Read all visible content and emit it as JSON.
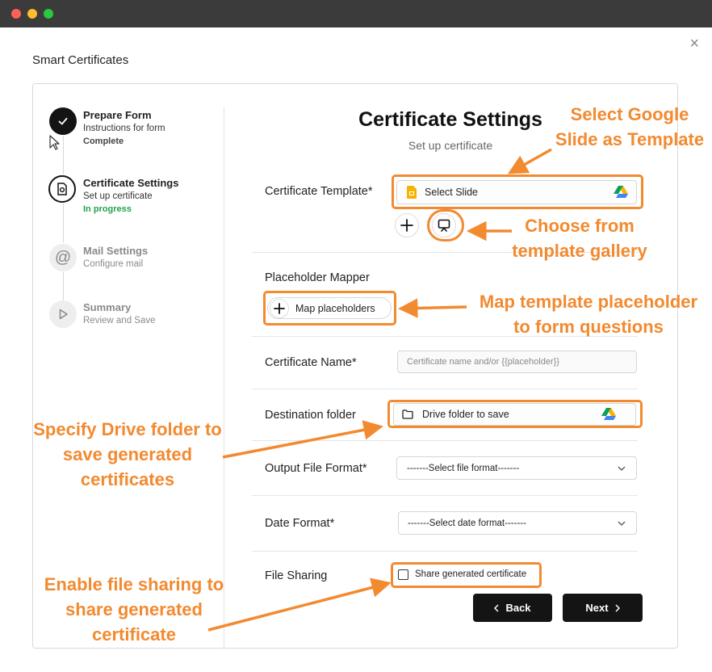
{
  "app": {
    "title": "Smart Certificates",
    "close_label": "×"
  },
  "steps": [
    {
      "title": "Prepare Form",
      "subtitle": "Instructions for form",
      "status": "Complete"
    },
    {
      "title": "Certificate Settings",
      "subtitle": "Set up certificate",
      "status": "In progress"
    },
    {
      "title": "Mail Settings",
      "subtitle": "Configure mail"
    },
    {
      "title": "Summary",
      "subtitle": "Review and Save"
    }
  ],
  "main": {
    "title": "Certificate Settings",
    "subtitle": "Set up certificate",
    "certificate_template": {
      "label": "Certificate Template*",
      "value": "Select Slide"
    },
    "placeholder_mapper": {
      "label": "Placeholder Mapper",
      "button": "Map placeholders"
    },
    "certificate_name": {
      "label": "Certificate Name*",
      "placeholder": "Certificate name and/or {{placeholder}}"
    },
    "destination_folder": {
      "label": "Destination folder",
      "value": "Drive folder to save"
    },
    "output_format": {
      "label": "Output File Format*",
      "value": "-------Select file format-------"
    },
    "date_format": {
      "label": "Date Format*",
      "value": "-------Select date format-------"
    },
    "file_sharing": {
      "label": "File Sharing",
      "checkbox_label": "Share generated certificate",
      "checked": false
    },
    "back_button": "Back",
    "next_button": "Next"
  },
  "annotations": {
    "select_slide": [
      "Select Google",
      "Slide as Template"
    ],
    "gallery": [
      "Choose from",
      "template gallery"
    ],
    "map": [
      "Map template placeholder",
      "to form questions"
    ],
    "drive": [
      "Specify Drive folder to",
      "save generated",
      "certificates"
    ],
    "sharing": [
      "Enable file sharing to",
      "share generated",
      "certificate"
    ]
  },
  "colors": {
    "accent": "#f28a30",
    "complete": "#141414",
    "in_progress": "#22a24a",
    "button_dark": "#141414"
  }
}
